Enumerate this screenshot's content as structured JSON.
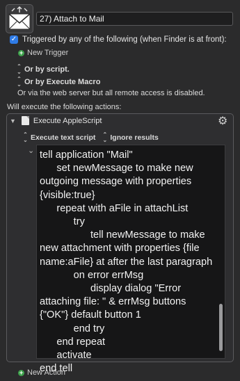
{
  "macro": {
    "name": "27) Attach to Mail"
  },
  "trigger": {
    "enabled_label": "Triggered by any of the following (when Finder is at front):",
    "new_trigger_label": "New Trigger",
    "or_by_script_label": "Or by script.",
    "or_by_execute_macro_label": "Or by Execute Macro",
    "web_server_text": "Or via the web server but all remote access is disabled."
  },
  "actions": {
    "will_execute_label": "Will execute the following actions:",
    "action_title": "Execute AppleScript",
    "option_execute_label": "Execute text script",
    "option_results_label": "Ignore results",
    "new_action_label": "New Action",
    "script_text": "tell application \"Mail\"\n      set newMessage to make new outgoing message with properties {visible:true}\n      repeat with aFile in attachList\n            try\n                  tell newMessage to make new attachment with properties {file name:aFile} at after the last paragraph\n            on error errMsg\n                  display dialog \"Error attaching file: \" & errMsg buttons {\"OK\"} default button 1\n            end try\n      end repeat\n      activate\nend tell"
  },
  "icons": {
    "macro_icon": "mail-envelope-icon",
    "gear": "gear-icon",
    "checkbox": "checkmark-icon",
    "add": "plus-circle-icon",
    "updown": "updown-chevron-icon"
  },
  "colors": {
    "background": "#2b2b2c",
    "checkbox_blue": "#2f7be6",
    "add_green": "#3fa34d",
    "script_bg": "#161617"
  }
}
